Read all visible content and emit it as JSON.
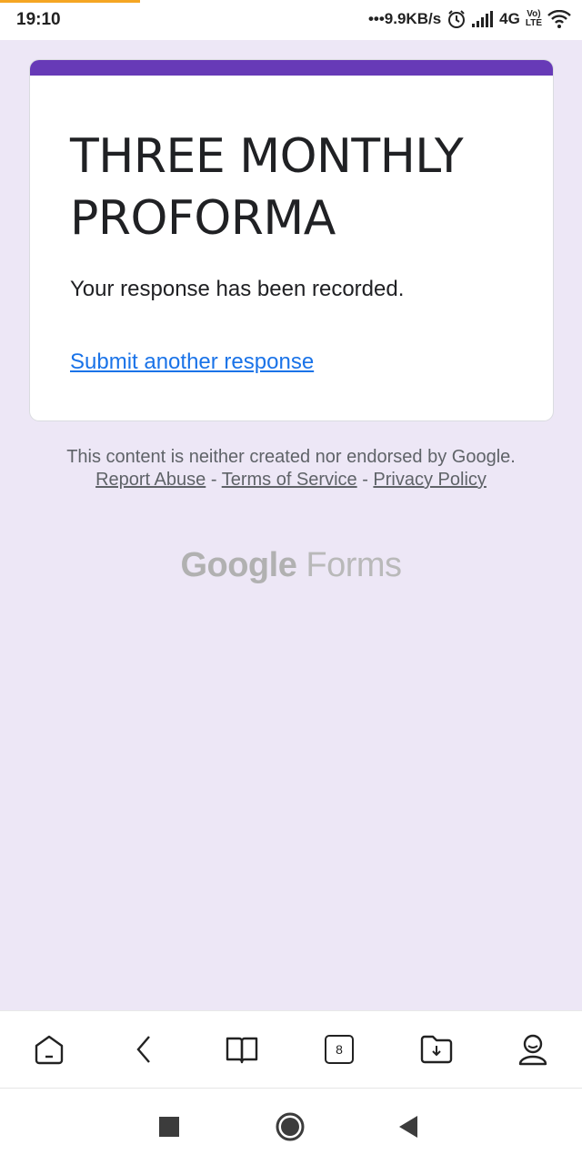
{
  "status_bar": {
    "time": "19:10",
    "net_speed": "•••9.9KB/s",
    "network": "4G",
    "volte_top": "Vo)",
    "volte_bottom": "LTE",
    "load_progress": 0.24
  },
  "form": {
    "title": "THREE MONTHLY PROFORMA",
    "confirmation": "Your response has been recorded.",
    "another_response_link": "Submit another response",
    "accent_color": "#673ab7"
  },
  "footer": {
    "disclaimer_text": "This content is neither created nor endorsed by Google.",
    "report_abuse": "Report Abuse",
    "separator1": " - ",
    "terms": "Terms of Service",
    "separator2": " - ",
    "privacy": "Privacy Policy",
    "brand_google": "Google",
    "brand_forms": "Forms"
  },
  "toolbar": {
    "tab_count": "8",
    "icons": [
      "home-icon",
      "back-icon",
      "bookmarks-icon",
      "tabs-icon",
      "downloads-icon",
      "profile-icon"
    ]
  },
  "navbar": {
    "icons": [
      "recent-apps-icon",
      "home-circle-icon",
      "back-triangle-icon"
    ]
  }
}
